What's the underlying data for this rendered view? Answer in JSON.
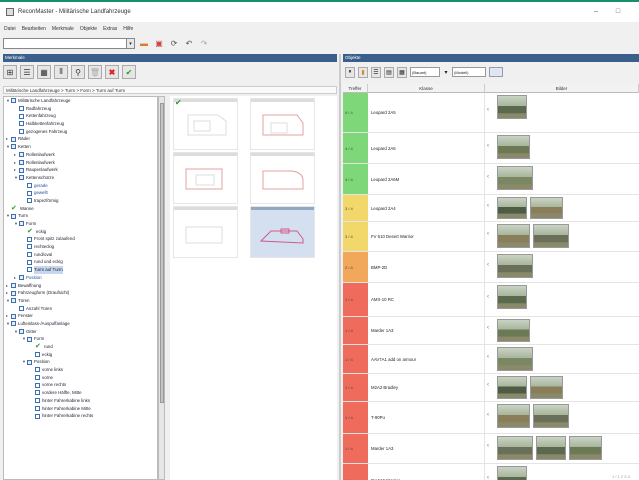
{
  "window": {
    "title": "ReconMaster - Militärische Landfahrzeuge",
    "minimize": "–",
    "maximize": "□"
  },
  "menu": [
    "Datei",
    "Bearbeiten",
    "Merkmale",
    "Objekte",
    "Extras",
    "Hilfe"
  ],
  "left_panel": {
    "header": "Merkmale",
    "breadcrumb": "Militärische Landfahrzeuge > Turm > Form > Turm auf Turm"
  },
  "tree": [
    {
      "label": "Militärische Landfahrzeuge",
      "indent": 0,
      "icon": "folder",
      "exp": "▼"
    },
    {
      "label": "Radfahrzeug",
      "indent": 1,
      "icon": "doc"
    },
    {
      "label": "Kettenfahrzeug",
      "indent": 1,
      "icon": "doc"
    },
    {
      "label": "Halbkettenfahrzeug",
      "indent": 1,
      "icon": "doc"
    },
    {
      "label": "gezogenes Fahrzeug",
      "indent": 1,
      "icon": "doc"
    },
    {
      "label": "Räder",
      "indent": 0,
      "icon": "folder",
      "exp": "▸"
    },
    {
      "label": "Ketten",
      "indent": 0,
      "icon": "folder",
      "exp": "▼"
    },
    {
      "label": "Rollenlaufwerk",
      "indent": 1,
      "icon": "folder",
      "exp": "▸"
    },
    {
      "label": "Rollenlaufwerk",
      "indent": 1,
      "icon": "folder",
      "exp": "▸"
    },
    {
      "label": "Raupenlaufwerk",
      "indent": 1,
      "icon": "folder",
      "exp": "▸"
    },
    {
      "label": "Kettenschürze",
      "indent": 1,
      "icon": "folder",
      "exp": "▼"
    },
    {
      "label": "gerade",
      "indent": 2,
      "icon": "doc",
      "blue": true
    },
    {
      "label": "gewellt",
      "indent": 2,
      "icon": "doc",
      "blue": true
    },
    {
      "label": "trapezförmig",
      "indent": 2,
      "icon": "doc"
    },
    {
      "label": "Wanne",
      "indent": 0,
      "icon": "check"
    },
    {
      "label": "Turm",
      "indent": 0,
      "icon": "folder",
      "exp": "▼"
    },
    {
      "label": "Form",
      "indent": 1,
      "icon": "folder",
      "exp": "▼"
    },
    {
      "label": "eckig",
      "indent": 2,
      "icon": "check"
    },
    {
      "label": "Front spitz zulaufend",
      "indent": 2,
      "icon": "doc"
    },
    {
      "label": "rechteckig",
      "indent": 2,
      "icon": "doc"
    },
    {
      "label": "rund/oval",
      "indent": 2,
      "icon": "doc"
    },
    {
      "label": "rund und eckig",
      "indent": 2,
      "icon": "doc"
    },
    {
      "label": "Turm auf Turm",
      "indent": 2,
      "icon": "doc",
      "sel": true
    },
    {
      "label": "Position",
      "indent": 1,
      "icon": "folder",
      "exp": "▸",
      "blue": true
    },
    {
      "label": "Bewaffnung",
      "indent": 0,
      "icon": "folder",
      "exp": "▸"
    },
    {
      "label": "Fahrzeugform (Draufsicht)",
      "indent": 0,
      "icon": "folder",
      "exp": "▸"
    },
    {
      "label": "Türen",
      "indent": 0,
      "icon": "folder",
      "exp": "▼"
    },
    {
      "label": "Anzahl Türen",
      "indent": 1,
      "icon": "doc"
    },
    {
      "label": "Fenster",
      "indent": 0,
      "icon": "folder",
      "exp": "▸"
    },
    {
      "label": "Lufteinlass-/Auspuffanlage",
      "indent": 0,
      "icon": "folder",
      "exp": "▼"
    },
    {
      "label": "Gitter",
      "indent": 1,
      "icon": "folder",
      "exp": "▼"
    },
    {
      "label": "Form",
      "indent": 2,
      "icon": "folder",
      "exp": "▼"
    },
    {
      "label": "rund",
      "indent": 3,
      "icon": "check"
    },
    {
      "label": "eckig",
      "indent": 3,
      "icon": "doc"
    },
    {
      "label": "Position",
      "indent": 2,
      "icon": "folder",
      "exp": "▼"
    },
    {
      "label": "vorne links",
      "indent": 3,
      "icon": "doc"
    },
    {
      "label": "vorne",
      "indent": 3,
      "icon": "doc"
    },
    {
      "label": "vorne rechts",
      "indent": 3,
      "icon": "doc"
    },
    {
      "label": "vordere Hälfte, Mitte",
      "indent": 3,
      "icon": "doc"
    },
    {
      "label": "hinter Fahrerkabine links",
      "indent": 3,
      "icon": "doc"
    },
    {
      "label": "hinter Fahrerkabine Mitte",
      "indent": 3,
      "icon": "doc"
    },
    {
      "label": "hinter Fahrerkabine rechts",
      "indent": 3,
      "icon": "doc"
    }
  ],
  "right_panel": {
    "header": "Objekte",
    "select1": "(Bauart)",
    "select2": "(Modell)",
    "columns": [
      "Treffer",
      "Klasse",
      "Bilder"
    ],
    "rows": [
      {
        "treffer": "4 / 4",
        "klasse": "Leopard 2A5",
        "color": "#7ed87a",
        "imgs": 1
      },
      {
        "treffer": "4 / 4",
        "klasse": "Leopard 2A6",
        "color": "#7ed87a",
        "imgs": 1
      },
      {
        "treffer": "4 / 4",
        "klasse": "Leopard 2A6M",
        "color": "#7ed87a",
        "imgs": 1
      },
      {
        "treffer": "3 / 4",
        "klasse": "Leopard 2A4",
        "color": "#f2d86a",
        "imgs": 2
      },
      {
        "treffer": "3 / 4",
        "klasse": "FV 510 Desert Warrior",
        "color": "#f2d86a",
        "imgs": 2
      },
      {
        "treffer": "2 / 4",
        "klasse": "BMP-2D",
        "color": "#f2a85a",
        "imgs": 1
      },
      {
        "treffer": "1 / 4",
        "klasse": "AMX-10 RC",
        "color": "#ef6b5c",
        "imgs": 1
      },
      {
        "treffer": "1 / 4",
        "klasse": "Marder 1A3",
        "color": "#ef6b5c",
        "imgs": 1
      },
      {
        "treffer": "1 / 4",
        "klasse": "AAV7A1 add on armour",
        "color": "#ef6b5c",
        "imgs": 1
      },
      {
        "treffer": "1 / 4",
        "klasse": "M2A2 Bradley",
        "color": "#ef6b5c",
        "imgs": 2
      },
      {
        "treffer": "1 / 4",
        "klasse": "T-90Pu",
        "color": "#ef6b5c",
        "imgs": 2
      },
      {
        "treffer": "1 / 4",
        "klasse": "Marder 1A3",
        "color": "#ef6b5c",
        "imgs": 3
      },
      {
        "treffer": "1 / 4",
        "klasse": "FV 510 Warrior",
        "color": "#ef6b5c",
        "imgs": 1
      }
    ],
    "status": "1 / 1 2 3 4"
  }
}
